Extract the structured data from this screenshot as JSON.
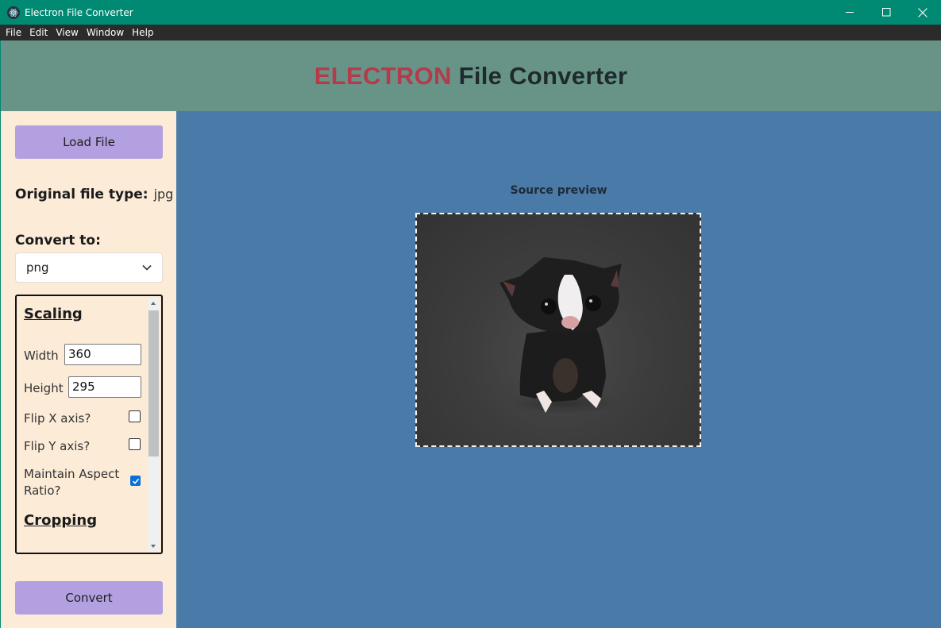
{
  "window": {
    "title": "Electron File Converter"
  },
  "menu": [
    "File",
    "Edit",
    "View",
    "Window",
    "Help"
  ],
  "header": {
    "accent": "ELECTRON",
    "rest": " File Converter"
  },
  "sidebar": {
    "load_label": "Load File",
    "original_label": "Original file type:",
    "original_value": "jpg",
    "convert_to_label": "Convert to:",
    "convert_to_value": "png",
    "convert_label": "Convert"
  },
  "options": {
    "scaling_title": "Scaling",
    "width_label": "Width",
    "width_value": "360",
    "height_label": "Height",
    "height_value": "295",
    "flip_x_label": "Flip X axis?",
    "flip_y_label": "Flip Y axis?",
    "aspect_label_1": "Maintain Aspect",
    "aspect_label_2": "Ratio?",
    "flip_x_checked": false,
    "flip_y_checked": false,
    "aspect_checked": true,
    "cropping_title": "Cropping"
  },
  "preview": {
    "label": "Source preview"
  },
  "icons": [
    "electron-app-icon",
    "minimize-icon",
    "maximize-icon",
    "close-icon",
    "chevron-down-icon",
    "checkmark-icon"
  ]
}
